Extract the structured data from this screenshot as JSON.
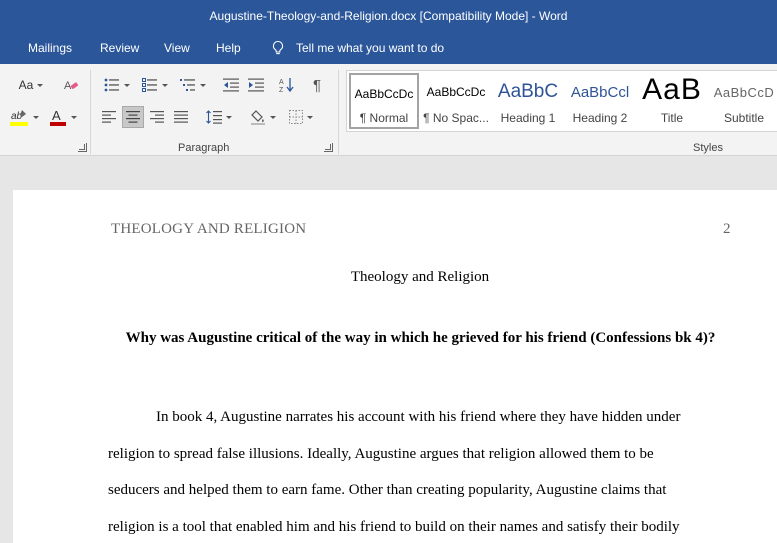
{
  "window": {
    "title": "Augustine-Theology-and-Religion.docx [Compatibility Mode]  -  Word"
  },
  "menu": {
    "tabs": [
      "Mailings",
      "Review",
      "View",
      "Help"
    ],
    "tell_me": "Tell me what you want to do"
  },
  "ribbon": {
    "font_group": {
      "change_case_label": "Aa"
    },
    "paragraph_group": {
      "label": "Paragraph"
    },
    "styles_group": {
      "label": "Styles",
      "items": [
        {
          "preview": "AaBbCcDc",
          "name": "¶ Normal",
          "selected": true
        },
        {
          "preview": "AaBbCcDc",
          "name": "¶ No Spac...",
          "selected": false
        },
        {
          "preview": "AaBbC",
          "name": "Heading 1",
          "selected": false
        },
        {
          "preview": "AaBbCcl",
          "name": "Heading 2",
          "selected": false
        },
        {
          "preview": "AaB",
          "name": "Title",
          "selected": false
        },
        {
          "preview": "AaBbCcD",
          "name": "Subtitle",
          "selected": false
        }
      ]
    },
    "colors": {
      "highlight": "#ffff00",
      "font_color": "#c00000"
    }
  },
  "document": {
    "header_title": "THEOLOGY AND RELIGION",
    "page_number": "2",
    "title": "Theology and Religion",
    "question": "Why was Augustine critical of the way in which he grieved for his friend (Confessions bk 4)?",
    "body_lines": [
      "In book 4, Augustine narrates his account with his friend where they have hidden under",
      "religion to spread false illusions. Ideally, Augustine argues that religion allowed them to be",
      "seducers and helped them to earn fame. Other than creating popularity, Augustine claims that",
      "religion is a tool that enabled him and his friend to build on their names and satisfy their bodily"
    ]
  },
  "theme": {
    "titlebar_bg": "#2b579a",
    "ribbon_bg": "#f3f3f3",
    "heading_blue": "#2f5496"
  }
}
